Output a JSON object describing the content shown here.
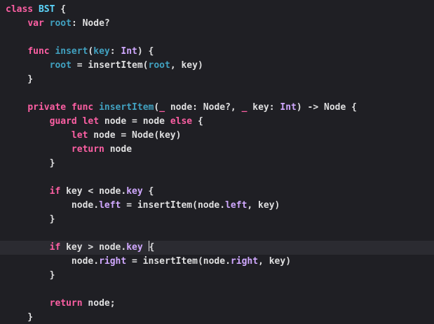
{
  "editor": {
    "colors": {
      "background": "#1f1f24",
      "current_line": "#2b2b31",
      "keyword": "#fc5fa3",
      "type_declaration": "#5dd8ff",
      "property_declaration": "#41a1c0",
      "system_api": "#d0a8ff",
      "plain": "#dfdfe0"
    },
    "current_line_index": 17,
    "lines": [
      [
        {
          "t": "class",
          "c": "kw"
        },
        {
          "t": " "
        },
        {
          "t": "BST",
          "c": "type"
        },
        {
          "t": " {"
        }
      ],
      [
        {
          "t": "    "
        },
        {
          "t": "var",
          "c": "kw"
        },
        {
          "t": " "
        },
        {
          "t": "root",
          "c": "prop"
        },
        {
          "t": ": Node?"
        }
      ],
      [],
      [
        {
          "t": "    "
        },
        {
          "t": "func",
          "c": "kw"
        },
        {
          "t": " "
        },
        {
          "t": "insert",
          "c": "prop"
        },
        {
          "t": "("
        },
        {
          "t": "key",
          "c": "prop"
        },
        {
          "t": ": "
        },
        {
          "t": "Int",
          "c": "api"
        },
        {
          "t": ") {"
        }
      ],
      [
        {
          "t": "        "
        },
        {
          "t": "root",
          "c": "prop"
        },
        {
          "t": " = insertItem("
        },
        {
          "t": "root",
          "c": "prop"
        },
        {
          "t": ", key)"
        }
      ],
      [
        {
          "t": "    }"
        }
      ],
      [],
      [
        {
          "t": "    "
        },
        {
          "t": "private",
          "c": "kw"
        },
        {
          "t": " "
        },
        {
          "t": "func",
          "c": "kw"
        },
        {
          "t": " "
        },
        {
          "t": "insertItem",
          "c": "prop"
        },
        {
          "t": "("
        },
        {
          "t": "_",
          "c": "kw"
        },
        {
          "t": " node: Node?, "
        },
        {
          "t": "_",
          "c": "kw"
        },
        {
          "t": " key: "
        },
        {
          "t": "Int",
          "c": "api"
        },
        {
          "t": ") -> Node {"
        }
      ],
      [
        {
          "t": "        "
        },
        {
          "t": "guard",
          "c": "kw"
        },
        {
          "t": " "
        },
        {
          "t": "let",
          "c": "kw"
        },
        {
          "t": " node = node "
        },
        {
          "t": "else",
          "c": "kw"
        },
        {
          "t": " {"
        }
      ],
      [
        {
          "t": "            "
        },
        {
          "t": "let",
          "c": "kw"
        },
        {
          "t": " node = Node(key)"
        }
      ],
      [
        {
          "t": "            "
        },
        {
          "t": "return",
          "c": "kw"
        },
        {
          "t": " node"
        }
      ],
      [
        {
          "t": "        }"
        }
      ],
      [],
      [
        {
          "t": "        "
        },
        {
          "t": "if",
          "c": "kw"
        },
        {
          "t": " key < node."
        },
        {
          "t": "key",
          "c": "api"
        },
        {
          "t": " {"
        }
      ],
      [
        {
          "t": "            node."
        },
        {
          "t": "left",
          "c": "api"
        },
        {
          "t": " = insertItem(node."
        },
        {
          "t": "left",
          "c": "api"
        },
        {
          "t": ", key)"
        }
      ],
      [
        {
          "t": "        }"
        }
      ],
      [],
      [
        {
          "t": "        "
        },
        {
          "t": "if",
          "c": "kw"
        },
        {
          "t": " key > node."
        },
        {
          "t": "key",
          "c": "api"
        },
        {
          "t": " "
        },
        {
          "caret": true
        },
        {
          "t": "{"
        }
      ],
      [
        {
          "t": "            node."
        },
        {
          "t": "right",
          "c": "api"
        },
        {
          "t": " = insertItem(node."
        },
        {
          "t": "right",
          "c": "api"
        },
        {
          "t": ", key)"
        }
      ],
      [
        {
          "t": "        }"
        }
      ],
      [],
      [
        {
          "t": "        "
        },
        {
          "t": "return",
          "c": "kw"
        },
        {
          "t": " node;"
        }
      ],
      [
        {
          "t": "    }"
        }
      ]
    ]
  }
}
